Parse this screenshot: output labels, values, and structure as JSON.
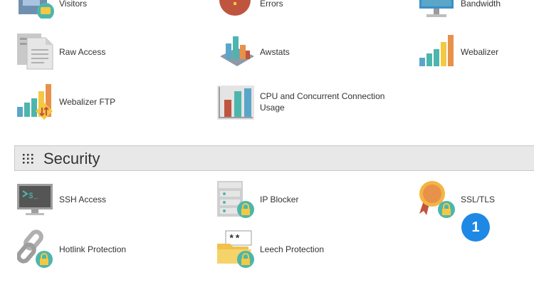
{
  "metrics": {
    "visitors": "Visitors",
    "errors": "Errors",
    "bandwidth": "Bandwidth",
    "raw_access": "Raw Access",
    "awstats": "Awstats",
    "webalizer": "Webalizer",
    "webalizer_ftp": "Webalizer FTP",
    "cpu_usage": "CPU and Concurrent Connection Usage"
  },
  "security": {
    "title": "Security",
    "ssh_access": "SSH Access",
    "ip_blocker": "IP Blocker",
    "ssl_tls": "SSL/TLS",
    "hotlink": "Hotlink Protection",
    "leech": "Leech Protection"
  },
  "callout": {
    "number": "1",
    "color": "#1e88e5"
  },
  "colors": {
    "teal": "#4db6ac",
    "orange": "#e8914a",
    "red": "#c0553f",
    "yellow": "#f5c842",
    "blue": "#5aa6c9"
  }
}
